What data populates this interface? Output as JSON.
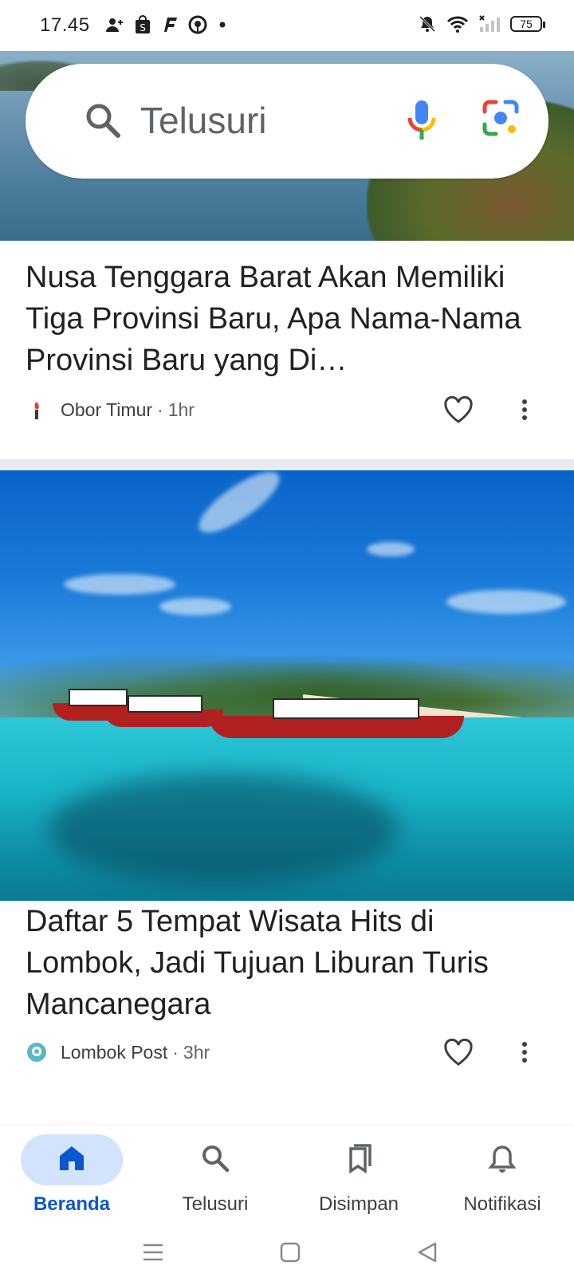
{
  "status_bar": {
    "time": "17.45",
    "battery": "75",
    "icons": [
      "person-add-icon",
      "shopee-icon",
      "f-app-icon",
      "pinterest-icon",
      "dot-icon",
      "mute-icon",
      "wifi-icon",
      "signal-icon",
      "battery-icon"
    ]
  },
  "search": {
    "placeholder": "Telusuri"
  },
  "articles": [
    {
      "title": "Nusa Tenggara Barat Akan Memiliki Tiga Provinsi Baru, Apa Nama-Nama Provinsi Baru yang Di…",
      "source": "Obor Timur",
      "separator": "·",
      "time": "1hr"
    },
    {
      "title": "Daftar 5 Tempat Wisata Hits di Lombok, Jadi Tujuan Liburan Turis Mancanegara",
      "source": "Lombok Post",
      "separator": "·",
      "time": "3hr"
    }
  ],
  "bottom_nav": {
    "items": [
      {
        "label": "Beranda",
        "icon": "home-icon",
        "active": true
      },
      {
        "label": "Telusuri",
        "icon": "search-icon",
        "active": false
      },
      {
        "label": "Disimpan",
        "icon": "saved-icon",
        "active": false
      },
      {
        "label": "Notifikasi",
        "icon": "bell-icon",
        "active": false
      }
    ]
  },
  "colors": {
    "accent": "#0b57d0",
    "active_pill": "#d3e3fd",
    "text": "#202124",
    "divider": "#e8eaed"
  }
}
